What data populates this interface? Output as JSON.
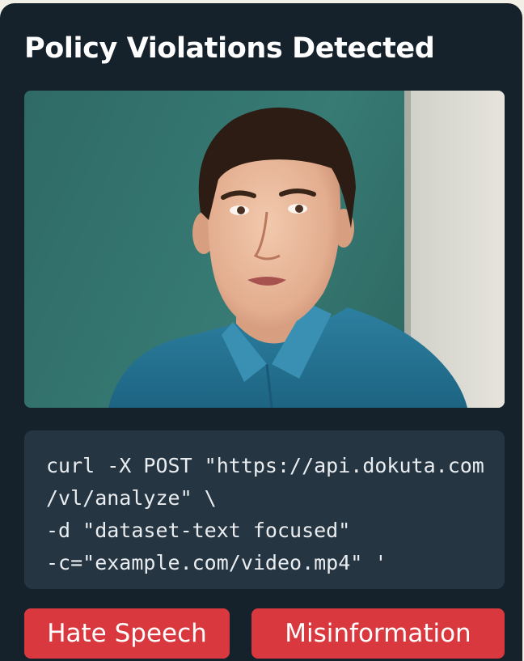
{
  "panel": {
    "title": "Policy Violations Detected"
  },
  "media": {
    "thumbnail_icon": "person-portrait-photo"
  },
  "code": {
    "lines": [
      "curl -X POST \"https://api.dokuta.com",
      "/vl/analyze\" \\",
      "-d \"dataset-text focused\"",
      "-c=\"example.com/video.mp4\" '"
    ]
  },
  "violations": [
    {
      "label": "Hate Speech",
      "color": "#d9383f"
    },
    {
      "label": "Misinformation",
      "color": "#d9383f"
    }
  ]
}
